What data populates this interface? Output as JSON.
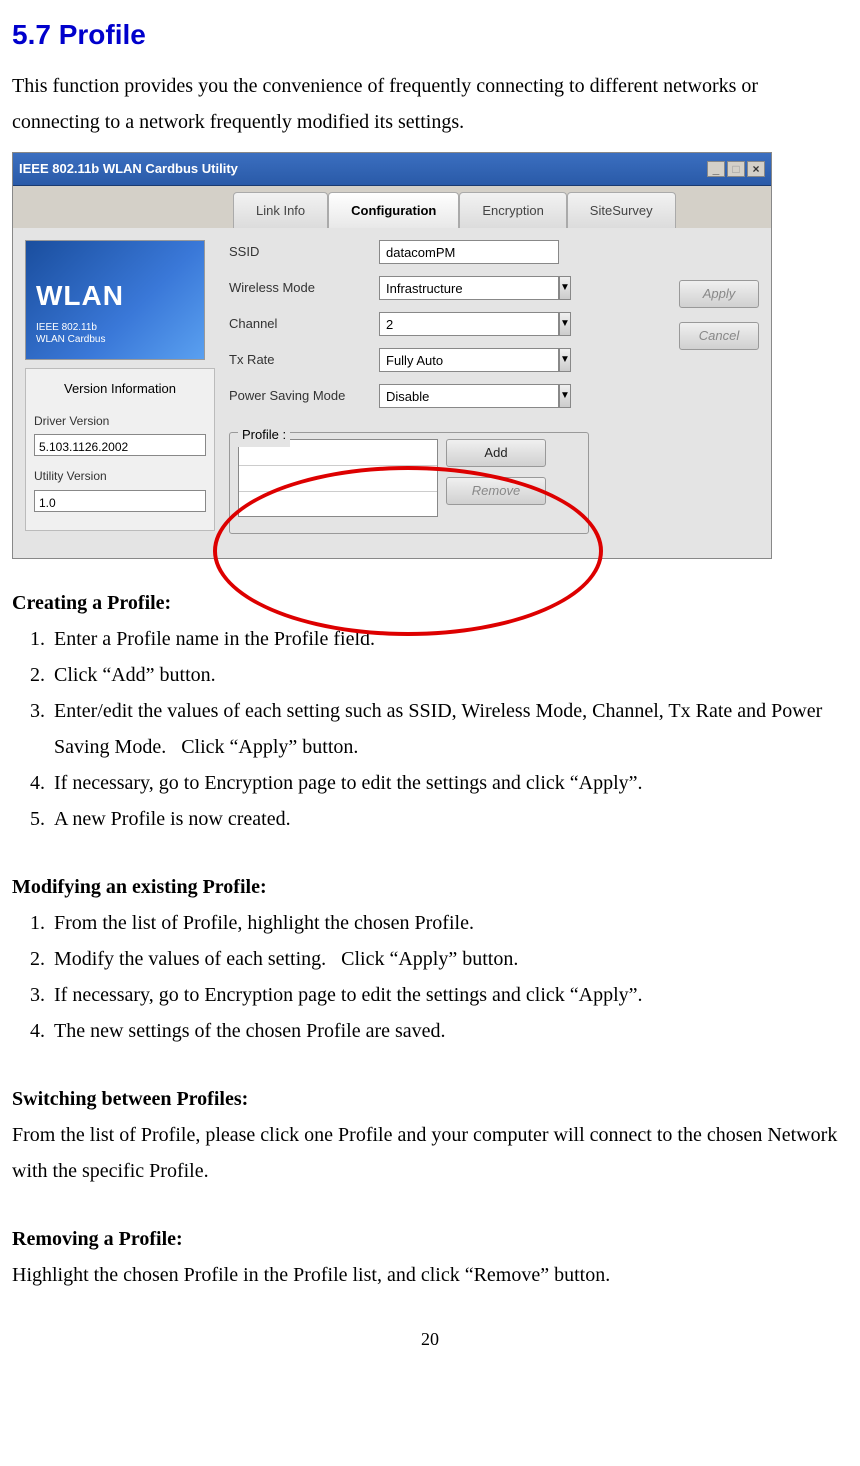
{
  "section": {
    "number": "5.7",
    "title": "Profile",
    "intro": "This function provides you the convenience of frequently connecting to different networks or connecting to a network frequently modified its settings."
  },
  "window": {
    "title": "IEEE 802.11b WLAN Cardbus Utility",
    "tabs": [
      "Link Info",
      "Configuration",
      "Encryption",
      "SiteSurvey"
    ],
    "activeTabIndex": 1,
    "wlanBanner": {
      "big": "WLAN",
      "line1": "IEEE 802.11b",
      "line2": "WLAN Cardbus"
    },
    "versionPanel": {
      "title": "Version Information",
      "driverLabel": "Driver Version",
      "driverValue": "5.103.1126.2002",
      "utilityLabel": "Utility Version",
      "utilityValue": "1.0"
    },
    "form": {
      "ssidLabel": "SSID",
      "ssidValue": "datacomPM",
      "modeLabel": "Wireless Mode",
      "modeValue": "Infrastructure",
      "channelLabel": "Channel",
      "channelValue": "2",
      "txLabel": "Tx Rate",
      "txValue": "Fully Auto",
      "psLabel": "Power Saving Mode",
      "psValue": "Disable",
      "applyLabel": "Apply",
      "cancelLabel": "Cancel"
    },
    "profile": {
      "legend": "Profile :",
      "addLabel": "Add",
      "removeLabel": "Remove"
    }
  },
  "creating": {
    "heading": "Creating a Profile:",
    "steps": [
      "Enter a Profile name in the Profile field.",
      "Click “Add” button.",
      "Enter/edit the values of each setting such as SSID, Wireless Mode, Channel, Tx Rate and Power Saving Mode.   Click “Apply” button.",
      "If necessary, go to Encryption page to edit the settings and click “Apply”.",
      "A new Profile is now created."
    ]
  },
  "modifying": {
    "heading": "Modifying an existing Profile:",
    "steps": [
      "From the list of Profile, highlight the chosen Profile.",
      "Modify the values of each setting.   Click “Apply” button.",
      "If necessary, go to Encryption page to edit the settings and click “Apply”.",
      "The new settings of the chosen Profile are saved."
    ]
  },
  "switching": {
    "heading": "Switching between Profiles:",
    "text": "From the list of Profile, please click one Profile and your computer will connect to the chosen Network with the specific Profile."
  },
  "removing": {
    "heading": "Removing a Profile:",
    "text": "Highlight the chosen Profile in the Profile list, and click “Remove” button."
  },
  "pageNumber": "20"
}
